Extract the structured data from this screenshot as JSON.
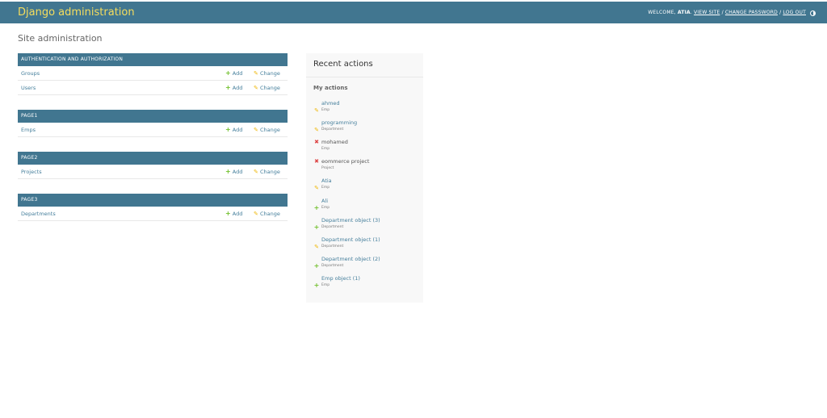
{
  "header": {
    "branding": "Django administration",
    "welcome_prefix": "WELCOME,",
    "username": "ATIA",
    "view_site": "VIEW SITE",
    "change_password": "CHANGE PASSWORD",
    "log_out": "LOG OUT",
    "separator": "/"
  },
  "page": {
    "title": "Site administration"
  },
  "apps": [
    {
      "caption": "AUTHENTICATION AND AUTHORIZATION",
      "models": [
        {
          "name": "Groups",
          "add": "Add",
          "change": "Change"
        },
        {
          "name": "Users",
          "add": "Add",
          "change": "Change"
        }
      ]
    },
    {
      "caption": "PAGE1",
      "models": [
        {
          "name": "Emps",
          "add": "Add",
          "change": "Change"
        }
      ]
    },
    {
      "caption": "PAGE2",
      "models": [
        {
          "name": "Projects",
          "add": "Add",
          "change": "Change"
        }
      ]
    },
    {
      "caption": "PAGE3",
      "models": [
        {
          "name": "Departments",
          "add": "Add",
          "change": "Change"
        }
      ]
    }
  ],
  "recent": {
    "title": "Recent actions",
    "subtitle": "My actions",
    "actions": [
      {
        "icon": "pencil-icon",
        "name": "ahmed",
        "type": "Emp",
        "deleted": false
      },
      {
        "icon": "pencil-icon",
        "name": "programming",
        "type": "Department",
        "deleted": false
      },
      {
        "icon": "delete-icon",
        "name": "mohamed",
        "type": "Emp",
        "deleted": true
      },
      {
        "icon": "delete-icon",
        "name": "eommerce project",
        "type": "Project",
        "deleted": true
      },
      {
        "icon": "pencil-icon",
        "name": "Atia",
        "type": "Emp",
        "deleted": false
      },
      {
        "icon": "plus-icon",
        "name": "Ali",
        "type": "Emp",
        "deleted": false
      },
      {
        "icon": "plus-icon",
        "name": "Department object (3)",
        "type": "Department",
        "deleted": false
      },
      {
        "icon": "pencil-icon",
        "name": "Department object (1)",
        "type": "Department",
        "deleted": false
      },
      {
        "icon": "plus-icon",
        "name": "Department object (2)",
        "type": "Department",
        "deleted": false
      },
      {
        "icon": "plus-icon",
        "name": "Emp object (1)",
        "type": "Emp",
        "deleted": false
      }
    ]
  },
  "colors": {
    "header_bg": "#417690",
    "branding": "#f5dd5d",
    "link": "#447e9b",
    "add_icon": "#70bf2b",
    "change_icon": "#efb80b",
    "delete_icon": "#dd4646"
  }
}
